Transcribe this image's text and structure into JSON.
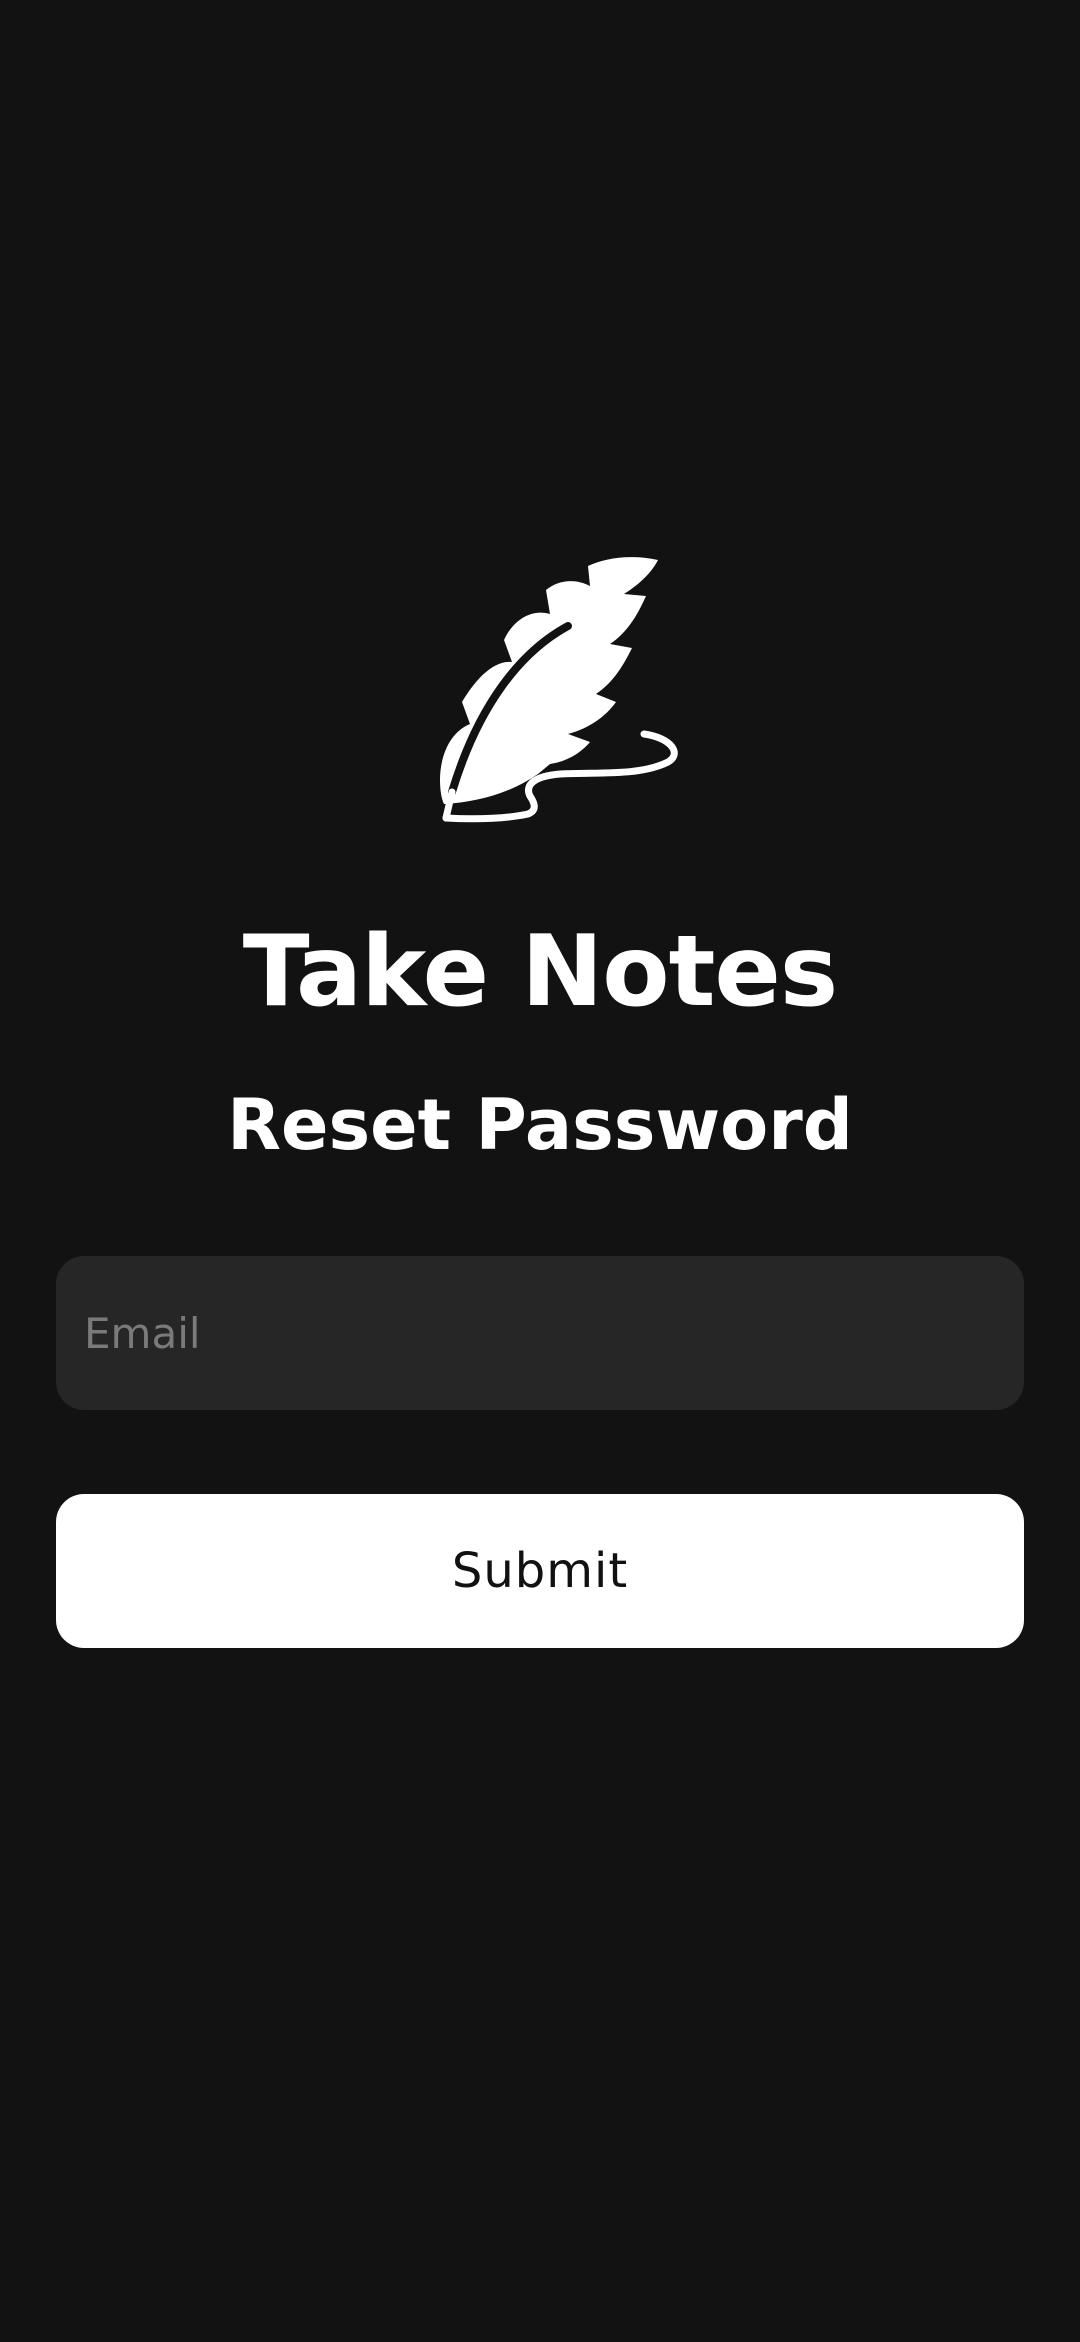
{
  "app": {
    "title": "Take Notes",
    "logo_icon": "feather-quill-icon"
  },
  "page": {
    "title": "Reset Password"
  },
  "form": {
    "email": {
      "value": "",
      "placeholder": "Email"
    },
    "submit_label": "Submit"
  },
  "colors": {
    "background": "#121212",
    "input_background": "#262626",
    "button_background": "#ffffff",
    "button_text": "#111111",
    "placeholder": "#7a7a7a",
    "text": "#ffffff"
  }
}
